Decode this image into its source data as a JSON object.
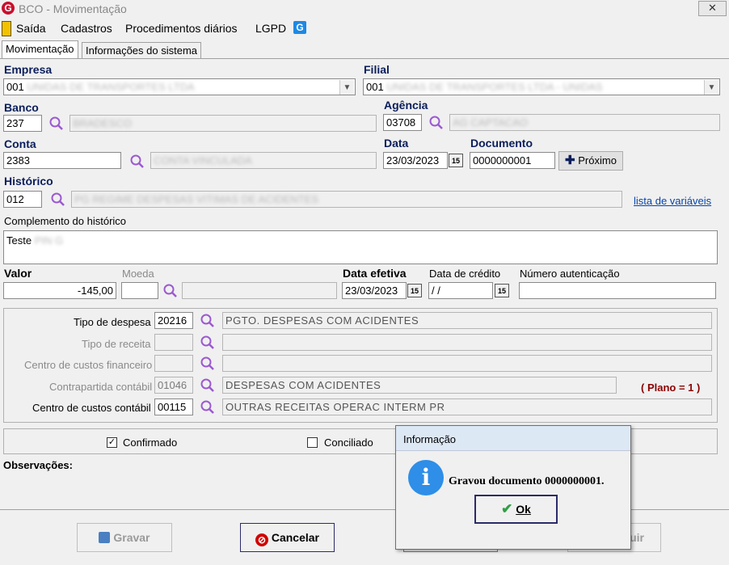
{
  "window": {
    "title": "BCO - Movimentação",
    "close": "✕"
  },
  "menu": {
    "exit": "Saída",
    "cadastros": "Cadastros",
    "procedimentos": "Procedimentos diários",
    "lgpd": "LGPD"
  },
  "tabs": [
    "Movimentação",
    "Informações do sistema"
  ],
  "form": {
    "empresa_label": "Empresa",
    "empresa_value": "001",
    "filial_label": "Filial",
    "filial_value": "001",
    "banco_label": "Banco",
    "banco_value": "237",
    "agencia_label": "Agência",
    "agencia_value": "03708",
    "conta_label": "Conta",
    "conta_value": "2383",
    "data_label": "Data",
    "data_value": "23/03/2023",
    "documento_label": "Documento",
    "documento_value": "0000000001",
    "proximo_label": "Próximo",
    "historico_label": "Histórico",
    "historico_value": "012",
    "variaveis_link": "lista de variáveis",
    "complemento_label": "Complemento do histórico",
    "complemento_value": "Teste",
    "valor_label": "Valor",
    "valor_value": "-145,00",
    "moeda_label": "Moeda",
    "data_efetiva_label": "Data efetiva",
    "data_efetiva_value": "23/03/2023",
    "data_credito_label": "Data de crédito",
    "data_credito_value": " /  /",
    "numero_auth_label": "Número autenticação",
    "cal_glyph": "15"
  },
  "classificacao": {
    "tipo_despesa_label": "Tipo de despesa",
    "tipo_despesa_code": "20216",
    "tipo_despesa_desc": "PGTO. DESPESAS COM ACIDENTES",
    "tipo_receita_label": "Tipo de receita",
    "centro_fin_label": "Centro de custos financeiro",
    "contrapartida_label": "Contrapartida contábil",
    "contrapartida_code": "01046",
    "contrapartida_desc": "DESPESAS COM ACIDENTES",
    "plano_label": "( Plano = 1 )",
    "centro_cont_label": "Centro de custos contábil",
    "centro_cont_code": "00115",
    "centro_cont_desc": "OUTRAS RECEITAS OPERAC INTERM PR"
  },
  "status": {
    "confirmado_label": "Confirmado",
    "confirmado_checked": true,
    "conciliado_label": "Conciliado",
    "conciliado_checked": false
  },
  "observacoes_label": "Observações:",
  "buttons": {
    "gravar": "Gravar",
    "cancelar": "Cancelar",
    "excluir_partial": "uir"
  },
  "dialog": {
    "title": "Informação",
    "message": "Gravou documento 0000000001.",
    "ok": "Ok",
    "info_glyph": "i"
  },
  "colors": {
    "accent_label": "#0b1e5b",
    "plano": "#8b0000",
    "link": "#0645ad",
    "cancel_icon": "#d00000",
    "info_icon": "#2e8ee8"
  }
}
